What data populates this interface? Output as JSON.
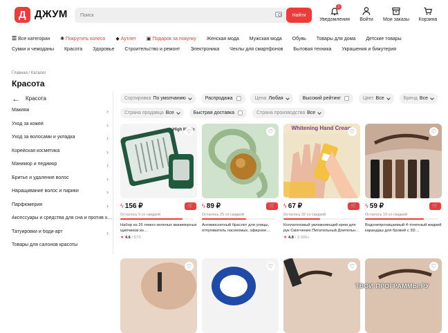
{
  "header": {
    "logo_letter": "Д",
    "logo_text": "ДЖУМ",
    "search_placeholder": "Поиск",
    "find_label": "Найти",
    "notifications_badge": "1",
    "items": [
      "Уведомления",
      "Войти",
      "Мои заказы",
      "Корзина"
    ]
  },
  "nav": {
    "row1": [
      "Все категории",
      "Покрутить колесо",
      "Аутлет",
      "Подарок за покупку",
      "Женская мода",
      "Мужская мода",
      "Обувь",
      "Товары для дома",
      "Детские товары"
    ],
    "row2": [
      "Сумки и чемоданы",
      "Красота",
      "Здоровье",
      "Строительство и ремонт",
      "Электроника",
      "Чехлы для смартфонов",
      "Бытовая техника",
      "Украшения и бижутерия"
    ]
  },
  "breadcrumb": [
    "Главная",
    "Каталог"
  ],
  "page_title": "Красота",
  "sidebar": {
    "back_label": "Красота",
    "categories": [
      "Макияж",
      "Уход за кожей",
      "Уход за волосами и укладка",
      "Корейская косметика",
      "Маникюр и педикюр",
      "Бритье и удаление волос",
      "Наращивание волос и парики",
      "Парфюмерия",
      "Аксессуары и средства для сна и против х…",
      "Татуировки и боди-арт",
      "Товары для салонов красоты"
    ]
  },
  "filters": [
    {
      "key": "Сортировка",
      "value": "По умолчанию",
      "type": "dropdown"
    },
    {
      "key": "",
      "value": "Распродажа",
      "type": "checkbox"
    },
    {
      "key": "Цена",
      "value": "Любая",
      "type": "dropdown"
    },
    {
      "key": "",
      "value": "Высокий рейтинг",
      "type": "checkbox"
    },
    {
      "key": "Цвет",
      "value": "Все",
      "type": "dropdown"
    },
    {
      "key": "Бренд",
      "value": "Все",
      "type": "dropdown"
    },
    {
      "key": "Страна продавца",
      "value": "Все",
      "type": "dropdown"
    },
    {
      "key": "",
      "value": "Быстрая доставка",
      "type": "checkbox"
    },
    {
      "key": "Страна производства",
      "value": "Все",
      "type": "dropdown"
    }
  ],
  "products": [
    {
      "price": "156 ₽",
      "remaining": "Осталось 9 со скидкой",
      "stock_fraction": 0.85,
      "name": "Набор из 26 темно-зеленых маникюрных щипчиков из…",
      "rating": "4.6",
      "reviews": "573",
      "image_text": "High Manic"
    },
    {
      "price": "89 ₽",
      "remaining": "Осталось 25 со скидкой",
      "stock_fraction": 0.6,
      "name": "Антимоскитный браслет для улицы, отпугиватель насекомых, эфирное…",
      "rating": "",
      "reviews": "",
      "image_text": ""
    },
    {
      "price": "67 ₽",
      "remaining": "Осталось 32 со скидкой",
      "stock_fraction": 0.5,
      "name": "Коллагеновый увлажняющий крем для рук Смягчение Питательный Длительн…",
      "rating": "4.8",
      "reviews": "3 000+",
      "image_text": "Whitening Hand Cream"
    },
    {
      "price": "59 ₽",
      "remaining": "Осталось 10 со скидкой",
      "stock_fraction": 0.8,
      "name": "Водонепроницаемый 4-точечный жидкий карандаш для бровей с 3D…",
      "rating": "",
      "reviews": "",
      "image_text": ""
    }
  ],
  "watermark": "ТВОИ ПРОГРАММЫ.РУ",
  "colors": {
    "accent": "#ef3a3a",
    "chip_bg": "#f1f1f1"
  }
}
